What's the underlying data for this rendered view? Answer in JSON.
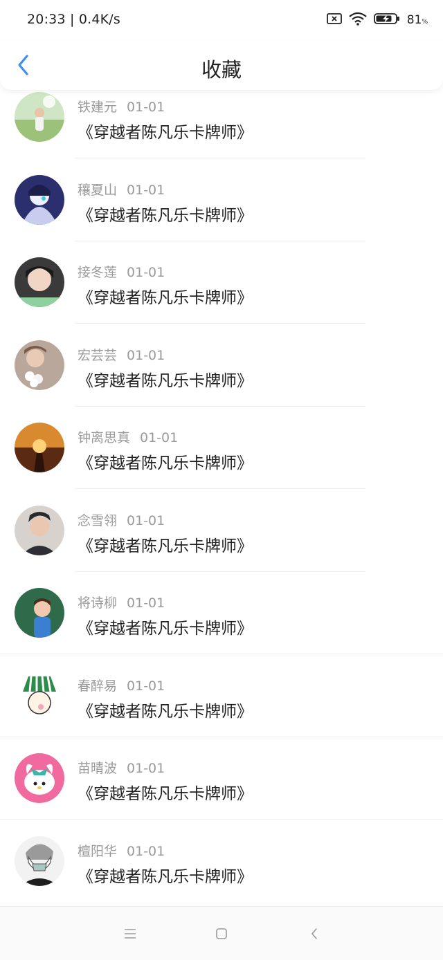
{
  "status": {
    "time": "20:33 | 0.4K/s",
    "battery_percent": "81",
    "battery_unit": "%"
  },
  "header": {
    "back_icon": "chevron-left-icon",
    "title": "收藏"
  },
  "favorites": [
    {
      "user": "铁建元",
      "date": "01-01",
      "book": "《穿越者陈凡乐卡牌师》"
    },
    {
      "user": "穰夏山",
      "date": "01-01",
      "book": "《穿越者陈凡乐卡牌师》"
    },
    {
      "user": "接冬莲",
      "date": "01-01",
      "book": "《穿越者陈凡乐卡牌师》"
    },
    {
      "user": "宏芸芸",
      "date": "01-01",
      "book": "《穿越者陈凡乐卡牌师》"
    },
    {
      "user": "钟离思真",
      "date": "01-01",
      "book": "《穿越者陈凡乐卡牌师》"
    },
    {
      "user": "念雪翎",
      "date": "01-01",
      "book": "《穿越者陈凡乐卡牌师》"
    },
    {
      "user": "将诗柳",
      "date": "01-01",
      "book": "《穿越者陈凡乐卡牌师》"
    },
    {
      "user": "春醉易",
      "date": "01-01",
      "book": "《穿越者陈凡乐卡牌师》"
    },
    {
      "user": "苗晴波",
      "date": "01-01",
      "book": "《穿越者陈凡乐卡牌师》"
    },
    {
      "user": "檀阳华",
      "date": "01-01",
      "book": "《穿越者陈凡乐卡牌师》"
    }
  ],
  "colors": {
    "accent": "#3d8ff0",
    "name_text": "#9a9a9a",
    "title_text": "#222222"
  }
}
